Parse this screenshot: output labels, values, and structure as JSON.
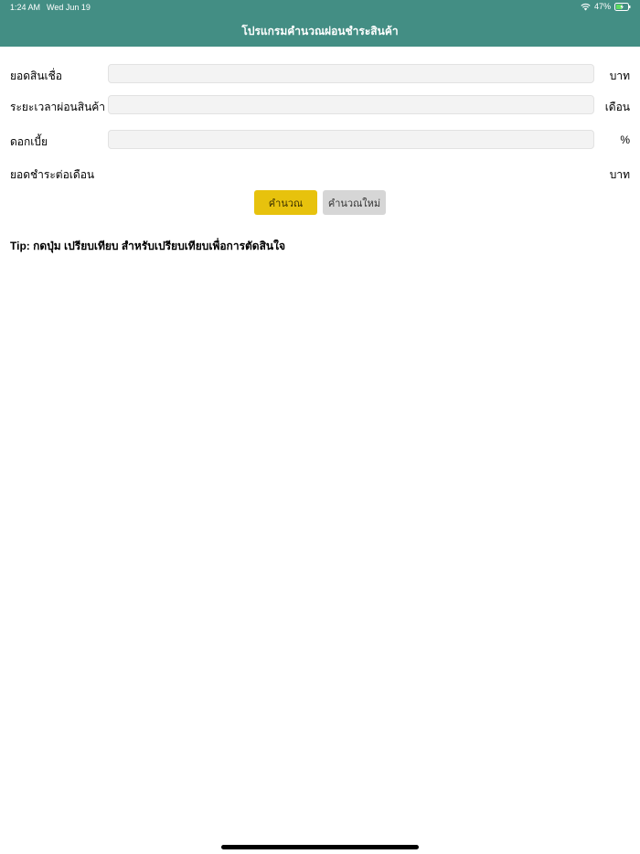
{
  "status_bar": {
    "time": "1:24 AM",
    "date": "Wed Jun 19",
    "battery": "47%",
    "icons": [
      "wifi-icon",
      "battery-charging-icon"
    ]
  },
  "header": {
    "title": "โปรแกรมคำนวณผ่อนชำระสินค้า"
  },
  "form": {
    "principal": {
      "label": "ยอดสินเชื่อ",
      "value": "",
      "unit": "บาท"
    },
    "duration": {
      "label": "ระยะเวลาผ่อนสินค้า",
      "value": "",
      "unit": "เดือน"
    },
    "interest": {
      "label": "ดอกเบี้ย",
      "value": "",
      "unit": "%"
    },
    "monthly": {
      "label": "ยอดชำระต่อเดือน",
      "unit": "บาท"
    }
  },
  "buttons": {
    "calculate": "คำนวณ",
    "reset": "คำนวณใหม่"
  },
  "tip": "Tip: กดปุ่ม เปรียบเทียบ สำหรับเปรียบเทียบเพื่อการตัดสินใจ",
  "colors": {
    "header_bg": "#438e84",
    "calculate_bg": "#e7c20d",
    "reset_bg": "#d6d6d6"
  }
}
